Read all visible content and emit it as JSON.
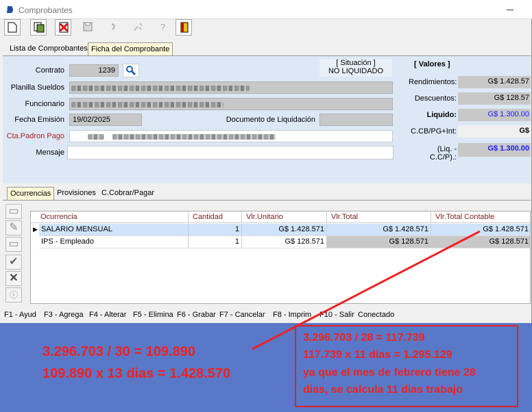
{
  "window": {
    "title": "Comprobantes"
  },
  "tabs": [
    "Lista de Comprobantes",
    "Ficha del Comprobante"
  ],
  "form": {
    "contrato_label": "Contrato",
    "contrato_value": "1239",
    "planilla_label": "Planilla Sueldos",
    "funcionario_label": "Funcionario",
    "fecha_label": "Fecha Emisión",
    "fecha_value": "19/02/2025",
    "documento_label": "Documento de Liquidación",
    "cta_label": "Cta.Padron Pago",
    "mensaje_label": "Mensaje"
  },
  "situacion": {
    "label": "[ Situación ]",
    "value": "NO LIQUIDADO"
  },
  "valores": {
    "title": "[ Valores ]",
    "rendimientos_label": "Rendimientos:",
    "rendimientos_value": "G$ 1.428.57",
    "descuentos_label": "Descuentos:",
    "descuentos_value": "G$ 128.57",
    "liquido_label": "Liquido:",
    "liquido_value": "G$ 1.300.00",
    "ccb_label": "C.CB/PG+Int:",
    "ccb_value": "G$",
    "liq_label": "(Liq. - C.C/P).:",
    "liq_value": "G$ 1.300.00"
  },
  "subtabs": [
    "Ocurrencias",
    "Provisiones",
    "C.Cobrar/Pagar"
  ],
  "grid": {
    "headers": [
      "Ocurrencia",
      "Cantidad",
      "Vlr.Unitario",
      "Vlr.Total",
      "Vlr.Total Contable"
    ],
    "rows": [
      [
        "SALARIO MENSUAL",
        "1",
        "G$ 1.428.571",
        "G$ 1.428.571",
        "G$ 1.428.571"
      ],
      [
        "IPS - Empleado",
        "1",
        "G$ 128.571",
        "G$ 128.571",
        "G$ 128.571"
      ]
    ]
  },
  "status": [
    "F1 - Ayud",
    "F3 - Agrega",
    "F4 - Alterar",
    "F5 - Elimina",
    "F6 - Grabar",
    "F7 - Cancelar",
    "F8 - Imprim",
    "F10 - Salir",
    "Conectado"
  ],
  "annotation": {
    "left_line1": "3.296.703 / 30 = 109.890",
    "left_line2": "109.890 x 13 dias = 1.428.570",
    "box_line1": "3.296.703 / 28 = 117.739",
    "box_line2": "117.739 x 11 dias = 1.295.129",
    "box_line3": "ya que el mes de febrero tiene 28",
    "box_line4": "dias, se calcula 11 dias trabajo"
  },
  "colors": {
    "accent_red": "#ee2222",
    "background_blue": "#5a78c8",
    "selected_row": "#cfe4fa",
    "link_blue": "#1a1aff"
  }
}
